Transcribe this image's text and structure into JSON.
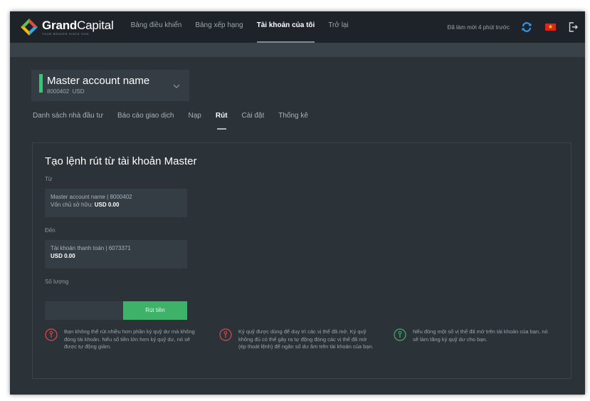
{
  "brand": {
    "name_bold": "Grand",
    "name_regular": "Capital",
    "tagline": "YOUR BROKER   SINCE 2006"
  },
  "nav": {
    "items": [
      "Bảng điều khiển",
      "Bảng xếp hạng",
      "Tài khoản của tôi",
      "Trở lại"
    ],
    "active_index": 2
  },
  "header": {
    "refresh_text": "Đã làm mới 4 phút trước",
    "flag_star": "★"
  },
  "account": {
    "name": "Master account name",
    "number": "8000402",
    "currency": "USD"
  },
  "tabs": [
    "Danh sách nhà đầu tư",
    "Báo cáo giao dịch",
    "Nạp",
    "Rút",
    "Cài đặt",
    "Thống kê"
  ],
  "form": {
    "title": "Tạo lệnh rút từ tài khoản Master",
    "from_label": "Từ",
    "from_line1": "Master account name | 8000402",
    "from_line2_prefix": "Vốn chủ sở hữu: ",
    "from_line2_value": "USD 0.00",
    "to_label": "Đến",
    "to_line1": "Tài khoản thanh toán | 6073371",
    "to_line2": "USD 0.00",
    "amount_label": "Số lượng",
    "amount_value": "",
    "submit_label": "Rút tiền"
  },
  "notes": [
    {
      "icon": "warning-icon",
      "color": "#e0484e",
      "text": "Bạn không thể rút nhiều hơn phần ký quỹ dư mà không đóng tài khoản. Nếu số tiền lớn hơn ký quỹ dư, nó sẽ được tự động giảm."
    },
    {
      "icon": "warning-icon",
      "color": "#e0484e",
      "text": "Ký quỹ được dùng để duy trì các vị thế đã mở. Ký quỹ không đủ có thể gây ra tự động đóng các vị thế đã mở (ép thoát lệnh) để ngăn số dư âm trên tài khoản của bạn."
    },
    {
      "icon": "info-icon",
      "color": "#3fb26a",
      "text": "Nếu đóng một số vị thế đã mở trên tài khoản của bạn, nó sẽ làm tăng ký quỹ dư cho bạn."
    }
  ],
  "colors": {
    "accent_green": "#3fb26a",
    "warning_red": "#e0484e",
    "sync_blue": "#2a9df4",
    "flag_red": "#da251d"
  }
}
